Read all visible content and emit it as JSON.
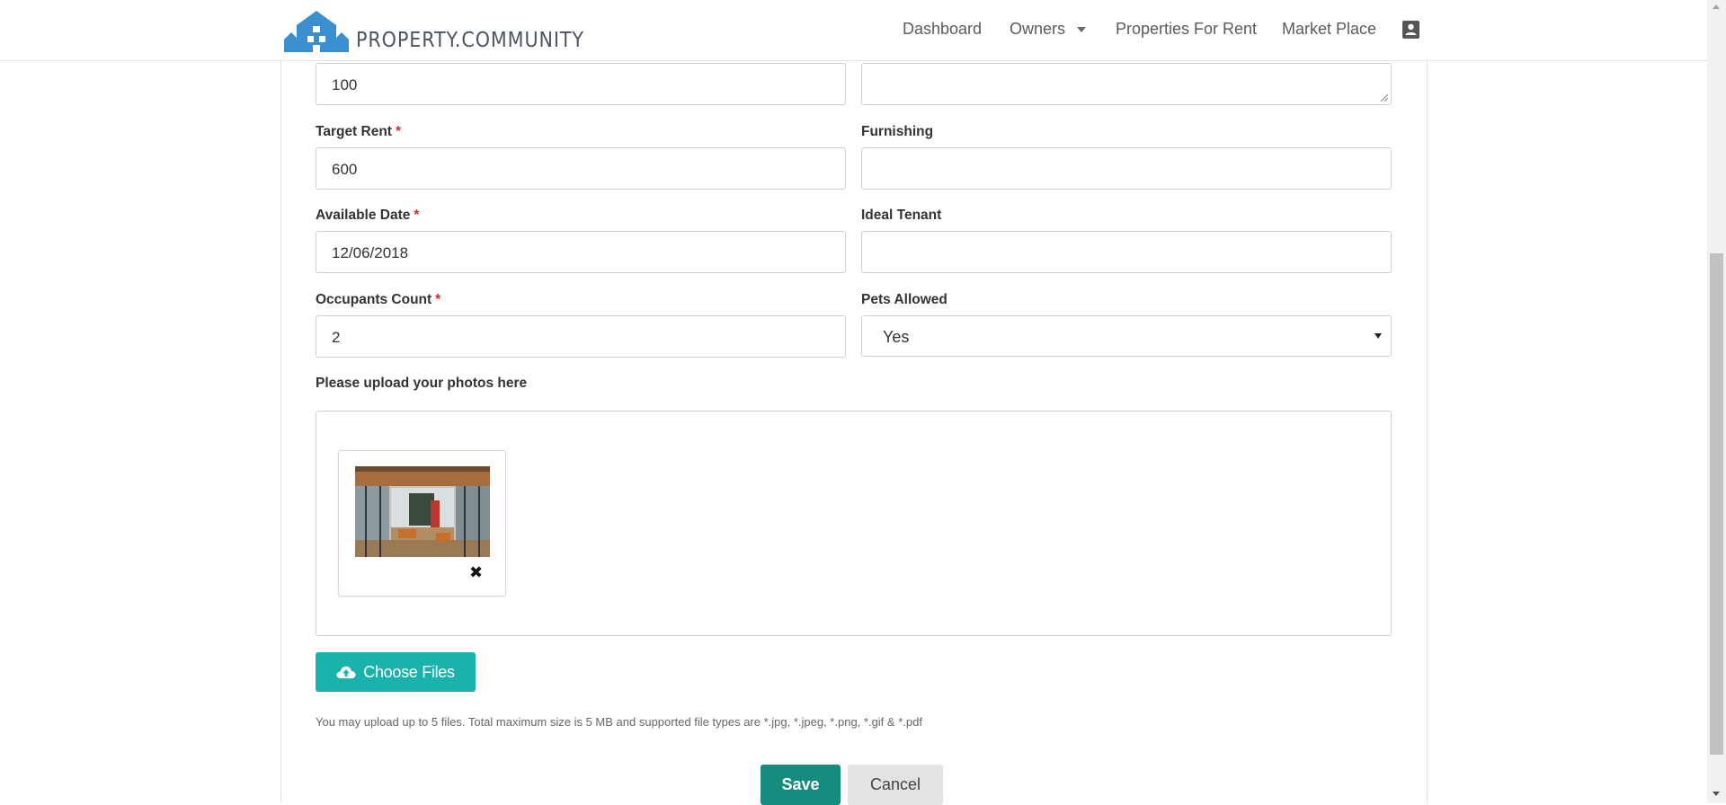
{
  "header": {
    "logo_text": "PROPERTY.COMMUNITY",
    "nav": {
      "dashboard": "Dashboard",
      "owners": "Owners",
      "properties_for_rent": "Properties For Rent",
      "market_place": "Market Place"
    }
  },
  "form": {
    "top_field_value": "100",
    "target_rent": {
      "label": "Target Rent",
      "required": "*",
      "value": "600"
    },
    "furnishing": {
      "label": "Furnishing",
      "value": ""
    },
    "available_date": {
      "label": "Available Date",
      "required": "*",
      "value": "12/06/2018"
    },
    "ideal_tenant": {
      "label": "Ideal Tenant",
      "value": ""
    },
    "occupants_count": {
      "label": "Occupants Count",
      "required": "*",
      "value": "2"
    },
    "pets_allowed": {
      "label": "Pets Allowed",
      "value": "Yes"
    },
    "upload": {
      "label": "Please upload your photos here",
      "choose_button": "Choose Files",
      "remove_icon": "✖",
      "help": "You may upload up to 5 files. Total maximum size is 5 MB and supported file types are *.jpg, *.jpeg, *.png, *.gif & *.pdf"
    },
    "save_button": "Save",
    "cancel_button": "Cancel"
  },
  "colors": {
    "brand_blue": "#3a8fcf",
    "teal_button": "#1ab3ac",
    "save_button": "#168c7f",
    "required_star": "#e02424"
  },
  "icons": {
    "user": "contact-card-icon",
    "upload": "cloud-upload-icon",
    "remove": "close-icon"
  }
}
